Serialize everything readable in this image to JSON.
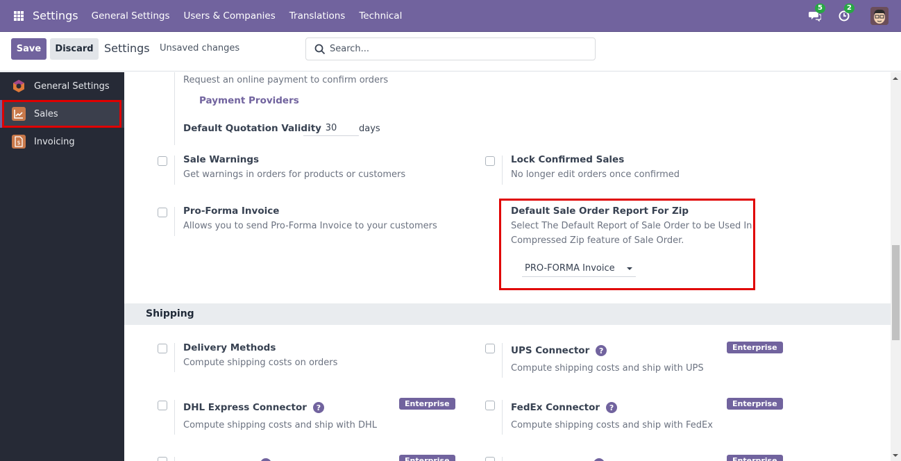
{
  "navbar": {
    "brand": "Settings",
    "menu": [
      "General Settings",
      "Users & Companies",
      "Translations",
      "Technical"
    ],
    "messages_count": "5",
    "activities_count": "2"
  },
  "control": {
    "save_label": "Save",
    "discard_label": "Discard",
    "title": "Settings",
    "status": "Unsaved changes",
    "search_placeholder": "Search..."
  },
  "sidebar": {
    "items": [
      {
        "label": "General Settings",
        "icon": "odoo-logo-icon",
        "active": false
      },
      {
        "label": "Sales",
        "icon": "sales-chart-icon",
        "active": true
      },
      {
        "label": "Invoicing",
        "icon": "invoice-icon",
        "active": false
      }
    ]
  },
  "sales": {
    "online_payment_desc": "Request an online payment to confirm orders",
    "payment_providers_link": "Payment Providers",
    "quotation_validity_label": "Default Quotation Validity",
    "quotation_validity_value": "30",
    "quotation_validity_unit": "days",
    "sale_warnings": {
      "title": "Sale Warnings",
      "desc": "Get warnings in orders for products or customers",
      "checked": false
    },
    "lock_confirmed": {
      "title": "Lock Confirmed Sales",
      "desc": "No longer edit orders once confirmed",
      "checked": false
    },
    "pro_forma": {
      "title": "Pro-Forma Invoice",
      "desc": "Allows you to send Pro-Forma Invoice to your customers",
      "checked": false
    },
    "zip_report": {
      "title": "Default Sale Order Report For Zip",
      "desc_line1": "Select The Default Report of Sale Order to be Used In",
      "desc_line2": "Compressed Zip feature of Sale Order.",
      "selected": "PRO-FORMA Invoice"
    }
  },
  "shipping": {
    "heading": "Shipping",
    "enterprise_label": "Enterprise",
    "delivery_methods": {
      "title": "Delivery Methods",
      "desc": "Compute shipping costs on orders",
      "checked": false
    },
    "ups": {
      "title": "UPS Connector",
      "desc": "Compute shipping costs and ship with UPS",
      "checked": false
    },
    "dhl": {
      "title": "DHL Express Connector",
      "desc": "Compute shipping costs and ship with DHL",
      "checked": false
    },
    "fedex": {
      "title": "FedEx Connector",
      "desc": "Compute shipping costs and ship with FedEx",
      "checked": false
    }
  },
  "colors": {
    "brand": "#71639e",
    "highlight": "#e00000",
    "sidebar_bg": "#262a36"
  }
}
